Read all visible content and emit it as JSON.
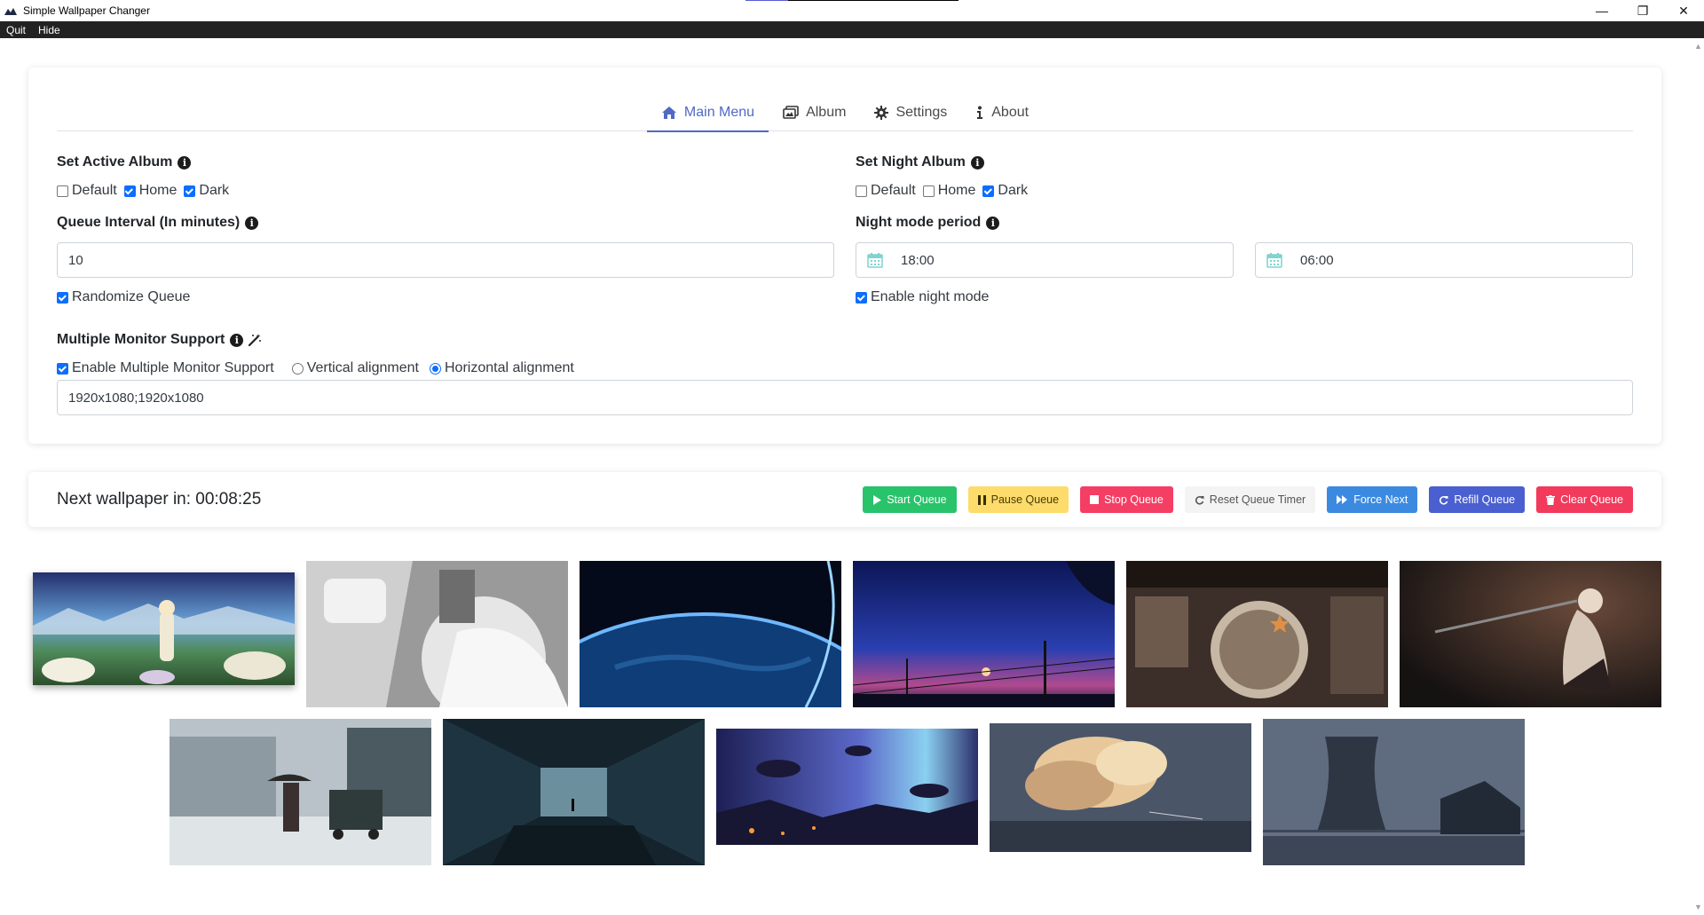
{
  "window": {
    "title": "Simple Wallpaper Changer",
    "controls": [
      "—",
      "❐",
      "✕"
    ]
  },
  "menubar": {
    "items": [
      "Quit",
      "Hide"
    ]
  },
  "tabs": [
    {
      "label": "Main Menu",
      "icon": "home-icon",
      "active": true
    },
    {
      "label": "Album",
      "icon": "images-icon",
      "active": false
    },
    {
      "label": "Settings",
      "icon": "gear-icon",
      "active": false
    },
    {
      "label": "About",
      "icon": "info-icon",
      "active": false
    }
  ],
  "active_album": {
    "label": "Set Active Album",
    "options": [
      {
        "label": "Default",
        "checked": false
      },
      {
        "label": "Home",
        "checked": true
      },
      {
        "label": "Dark",
        "checked": true
      }
    ]
  },
  "night_album": {
    "label": "Set Night Album",
    "options": [
      {
        "label": "Default",
        "checked": false
      },
      {
        "label": "Home",
        "checked": false
      },
      {
        "label": "Dark",
        "checked": true
      }
    ]
  },
  "queue_interval": {
    "label": "Queue Interval (In minutes)",
    "value": "10"
  },
  "night_period": {
    "label": "Night mode period",
    "start": "18:00",
    "end": "06:00"
  },
  "randomize": {
    "label": "Randomize Queue",
    "checked": true
  },
  "night_enable": {
    "label": "Enable night mode",
    "checked": true
  },
  "multi_monitor": {
    "label": "Multiple Monitor Support",
    "enable_label": "Enable Multiple Monitor Support",
    "enabled": true,
    "vertical_label": "Vertical alignment",
    "horizontal_label": "Horizontal alignment",
    "alignment": "horizontal",
    "resolutions": "1920x1080;1920x1080"
  },
  "queue": {
    "next_text": "Next wallpaper in: 00:08:25",
    "buttons": [
      {
        "label": "Start Queue",
        "icon": "play-icon",
        "color": "#28c36a",
        "text_color": "#ffffff"
      },
      {
        "label": "Pause Queue",
        "icon": "pause-icon",
        "color": "#fddc6c",
        "text_color": "#4a3b00"
      },
      {
        "label": "Stop Queue",
        "icon": "stop-icon",
        "color": "#f53e64",
        "text_color": "#ffffff"
      },
      {
        "label": "Reset Queue Timer",
        "icon": "reset-icon",
        "color": "#f4f4f4",
        "text_color": "#555555"
      },
      {
        "label": "Force Next",
        "icon": "forward-icon",
        "color": "#3c8ae0",
        "text_color": "#ffffff"
      },
      {
        "label": "Refill Queue",
        "icon": "refill-icon",
        "color": "#4a5fd0",
        "text_color": "#ffffff"
      },
      {
        "label": "Clear Queue",
        "icon": "trash-icon",
        "color": "#f23a5c",
        "text_color": "#ffffff"
      }
    ]
  },
  "gallery": {
    "images": [
      {
        "name": "flower-field-girl",
        "selected": true
      },
      {
        "name": "white-robot-girl",
        "selected": false
      },
      {
        "name": "earth-from-space",
        "selected": false
      },
      {
        "name": "night-sky-powerlines",
        "selected": false
      },
      {
        "name": "cockpit-girl-star",
        "selected": false
      },
      {
        "name": "sword-knight",
        "selected": false
      },
      {
        "name": "rainy-street-girl",
        "selected": false
      },
      {
        "name": "dark-corridor-stairs",
        "selected": false
      },
      {
        "name": "floating-islands-aurora",
        "selected": false
      },
      {
        "name": "sunset-clouds",
        "selected": false
      },
      {
        "name": "cooling-tower-lake",
        "selected": false
      }
    ]
  }
}
